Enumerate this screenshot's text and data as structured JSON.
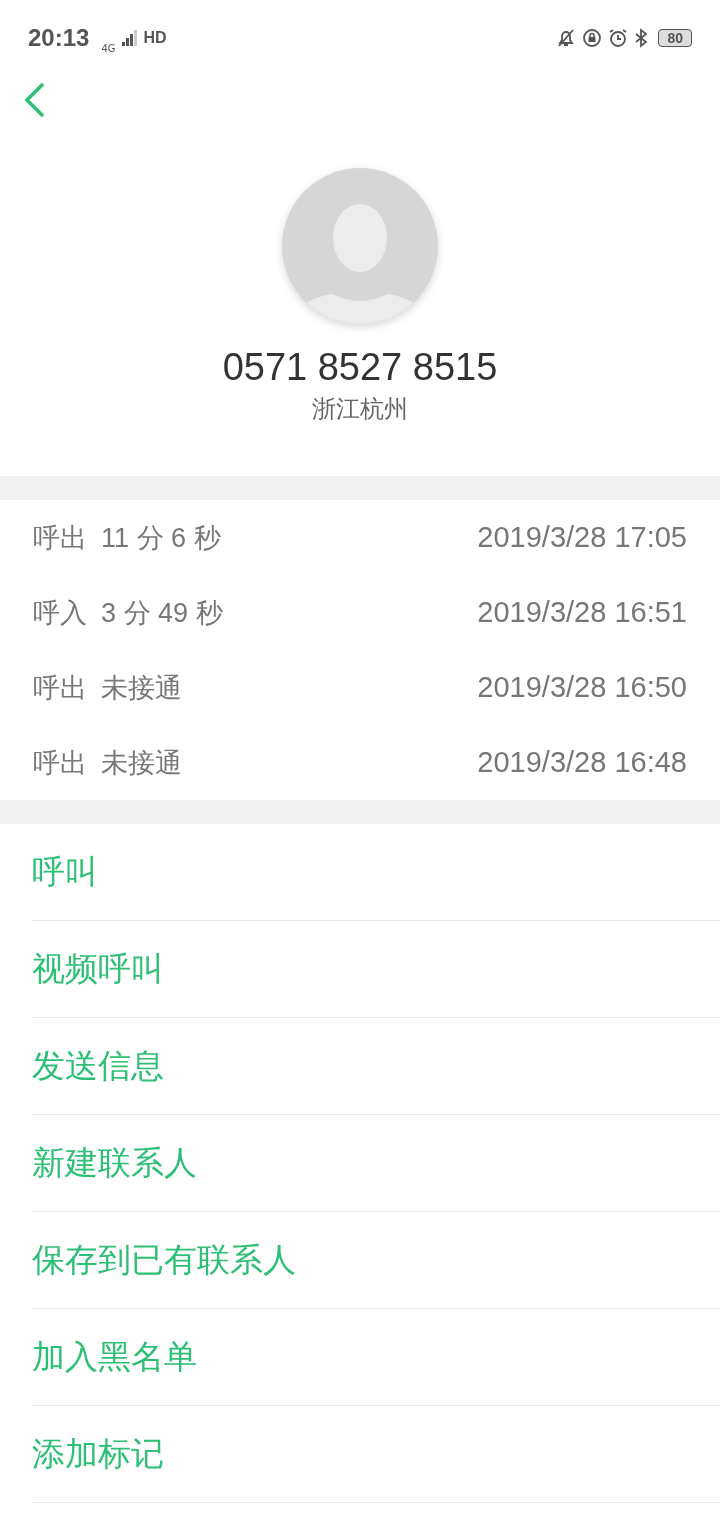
{
  "status_bar": {
    "time": "20:13",
    "network": "4G",
    "hd": "HD",
    "battery": "80"
  },
  "contact": {
    "number": "0571 8527 8515",
    "location": "浙江杭州"
  },
  "calls": [
    {
      "type": "呼出",
      "duration": "11 分 6 秒",
      "time": "2019/3/28 17:05"
    },
    {
      "type": "呼入",
      "duration": "3 分 49 秒",
      "time": "2019/3/28 16:51"
    },
    {
      "type": "呼出",
      "duration": "未接通",
      "time": "2019/3/28 16:50"
    },
    {
      "type": "呼出",
      "duration": "未接通",
      "time": "2019/3/28 16:48"
    }
  ],
  "actions": [
    "呼叫",
    "视频呼叫",
    "发送信息",
    "新建联系人",
    "保存到已有联系人",
    "加入黑名单",
    "添加标记"
  ]
}
